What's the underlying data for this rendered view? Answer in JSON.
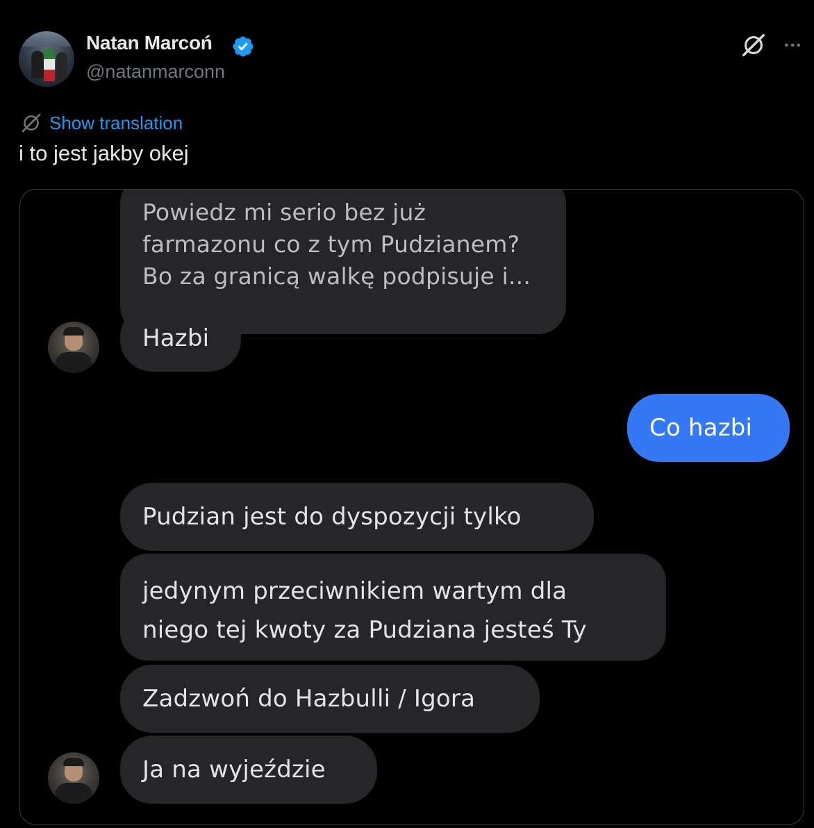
{
  "post": {
    "author": {
      "display_name": "Natan Marcoń",
      "handle": "@natanmarconn",
      "verified": true
    },
    "show_translation": "Show translation",
    "text": "i to jest jakby okej",
    "accent_color": "#1d9bf0"
  },
  "chat": {
    "quoted_message": {
      "line1": "Powiedz mi serio bez już",
      "line2": "farmazonu co z tym Pudzianem?",
      "line3": "Bo za granicą walkę podpisuje i..."
    },
    "messages": [
      {
        "from": "other",
        "text": "Hazbi"
      },
      {
        "from": "me",
        "text": "Co hazbi"
      },
      {
        "from": "other",
        "text": "Pudzian jest do dyspozycji tylko"
      },
      {
        "from": "other",
        "line1": "jedynym przeciwnikiem wartym dla",
        "line2": "niego tej kwoty za Pudziana jesteś Ty"
      },
      {
        "from": "other",
        "text": "Zadzwoń do Hazbulli / Igora"
      },
      {
        "from": "other",
        "text": "Ja na wyjeździe"
      }
    ],
    "colors": {
      "incoming_bubble": "#262628",
      "outgoing_bubble": "#3478f6"
    }
  },
  "icons": {
    "verified": "verified-badge-icon",
    "grok": "grok-icon",
    "more": "more-icon",
    "translate": "translate-icon"
  }
}
